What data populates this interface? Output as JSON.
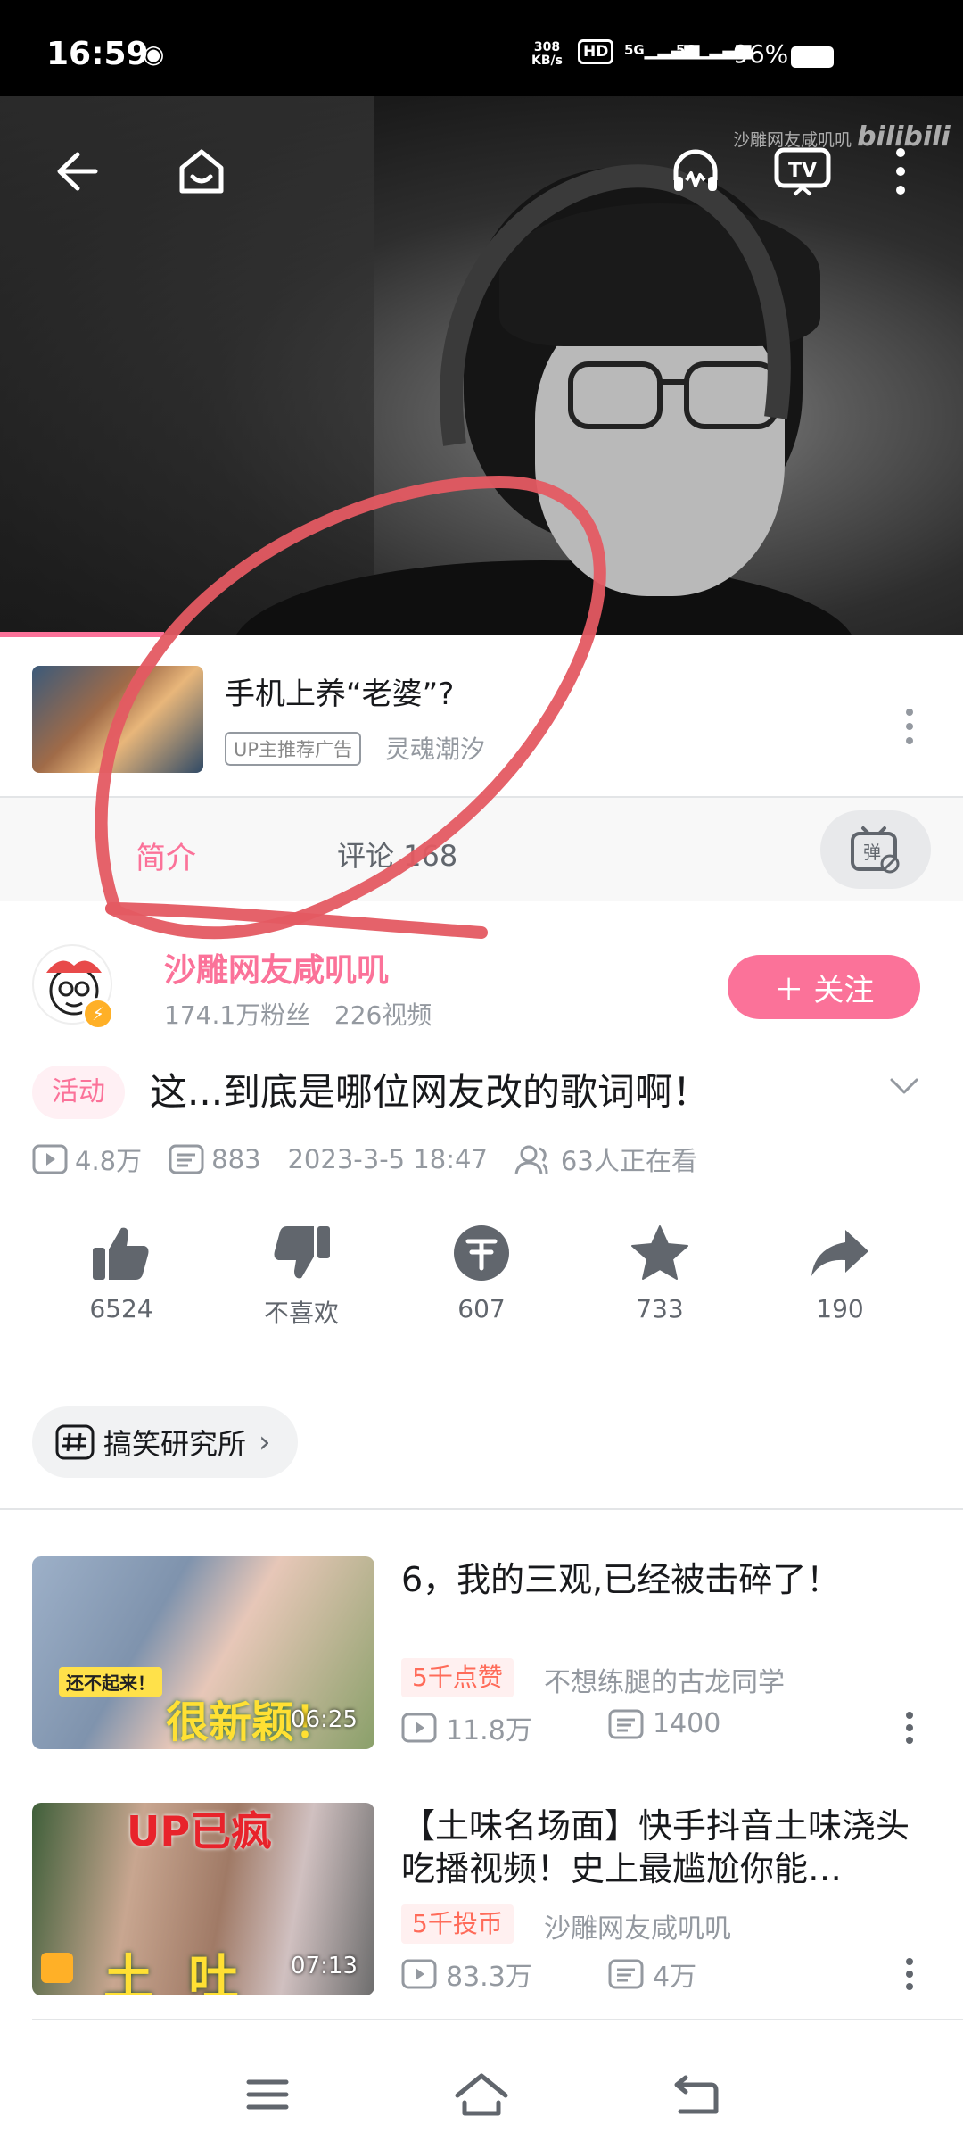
{
  "status_bar": {
    "time": "16:59",
    "net_speed_value": "308",
    "net_speed_unit": "KB/s",
    "hd_badge": "HD",
    "signal_1": "5G",
    "signal_2": "5G",
    "battery": "96%"
  },
  "player": {
    "watermark_name": "沙雕网友咸叽叽",
    "watermark_logo": "bilibili",
    "progress_fraction": 0.17,
    "icons": [
      "back-arrow-icon",
      "home-icon",
      "headphones-icon",
      "tv-cast-icon",
      "more-vertical-icon"
    ]
  },
  "ad": {
    "title": "手机上养“老婆”?",
    "badge": "UP主推荐广告",
    "source": "灵魂潮汐"
  },
  "tabs": {
    "intro": "简介",
    "comments": "评论 168",
    "danmaku_icon": "danmaku-toggle-icon"
  },
  "uploader": {
    "name": "沙雕网友咸叽叽",
    "fans": "174.1万粉丝",
    "videos": "226视频",
    "follow_label": "＋ 关注"
  },
  "video": {
    "tag": "活动",
    "title": "这...到底是哪位网友改的歌词啊！",
    "views": "4.8万",
    "danmaku": "883",
    "date": "2023-3-5 18:47",
    "watching": "63人正在看"
  },
  "actions": {
    "like": "6524",
    "dislike": "不喜欢",
    "coin": "607",
    "favorite": "733",
    "share": "190"
  },
  "topic": {
    "label": "搞笑研究所"
  },
  "recommendations": [
    {
      "title": "6，我的三观,已经被击碎了！",
      "duration": "06:25",
      "thumb_caption": "很新颖！",
      "thumb_sticker": "还不起来！",
      "tag": "5千点赞",
      "author": "不想练腿的古龙同学",
      "views": "11.8万",
      "danmaku": "1400"
    },
    {
      "title": "【土味名场面】快手抖音土味浇头吃播视频！史上最尴尬你能…",
      "duration": "07:13",
      "thumb_caption": "土 吐 了！",
      "thumb_sticker": "UP已疯",
      "tag": "5千投币",
      "author": "沙雕网友咸叽叽",
      "views": "83.3万",
      "danmaku": "4万"
    }
  ],
  "colors": {
    "accent_pink": "#fb7299",
    "annotation_red": "#e45a62",
    "tag_orange": "#ff6b59"
  }
}
